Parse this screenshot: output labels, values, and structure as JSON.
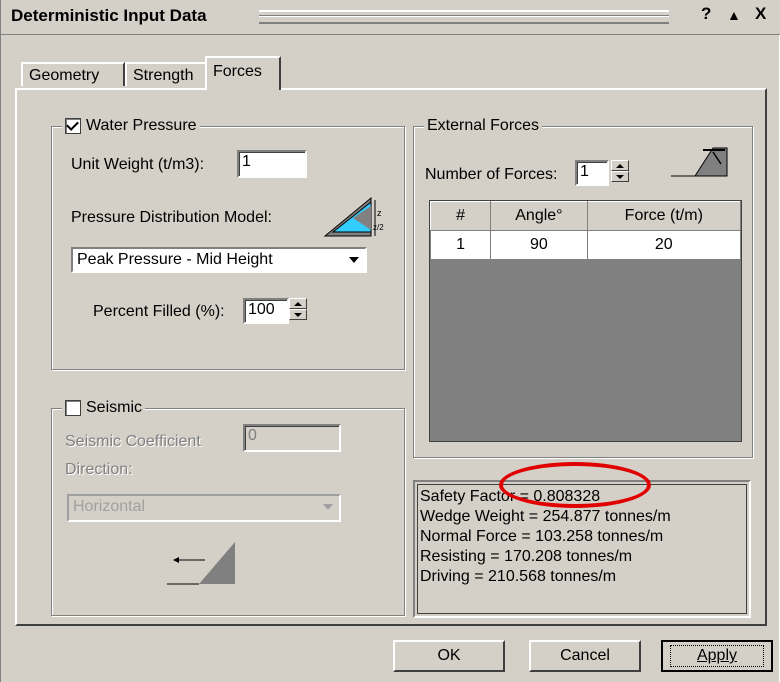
{
  "window": {
    "title": "Deterministic Input Data",
    "help_glyph": "?",
    "collapse_glyph": "▲",
    "close_glyph": "X"
  },
  "tabs": [
    {
      "label": "Geometry"
    },
    {
      "label": "Strength"
    },
    {
      "label": "Forces"
    }
  ],
  "water_pressure": {
    "label": "Water Pressure",
    "checked": true,
    "unit_weight_label": "Unit Weight (t/m3):",
    "unit_weight_value": "1",
    "model_label": "Pressure Distribution Model:",
    "model_value": "Peak Pressure - Mid Height",
    "percent_filled_label": "Percent Filled (%):",
    "percent_filled_value": "100",
    "icon": "wedge-water-pressure-icon"
  },
  "seismic": {
    "label": "Seismic",
    "checked": false,
    "coefficient_label": "Seismic Coefficient",
    "coefficient_value": "0",
    "direction_label": "Direction:",
    "direction_value": "Horizontal",
    "icon": "seismic-direction-icon"
  },
  "external_forces": {
    "label": "External Forces",
    "count_label": "Number of Forces:",
    "count_value": "1",
    "icon": "external-force-icon",
    "table": {
      "headers": [
        "#",
        "Angle°",
        "Force (t/m)"
      ],
      "rows": [
        [
          "1",
          "90",
          "20"
        ]
      ]
    }
  },
  "results": {
    "lines": [
      "Safety Factor = 0.808328",
      "Wedge Weight = 254.877 tonnes/m",
      "Normal Force = 103.258 tonnes/m",
      "Resisting = 170.208 tonnes/m",
      "Driving = 210.568 tonnes/m"
    ],
    "highlight_color": "#e00000"
  },
  "buttons": {
    "ok": "OK",
    "cancel": "Cancel",
    "apply": "Apply"
  }
}
